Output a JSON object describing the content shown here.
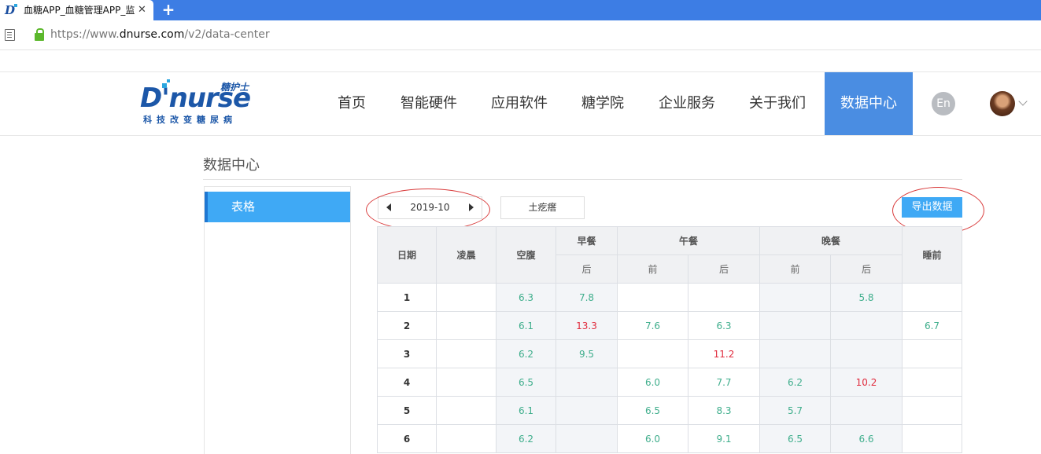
{
  "browser": {
    "tab_title": "血糖APP_血糖管理APP_监测",
    "tab_close": "✕",
    "new_tab": "+",
    "url_prefix": "https://www.",
    "url_domain": "dnurse.com",
    "url_path": "/v2/data-center"
  },
  "header": {
    "logo_word": "D'nurse",
    "logo_brand": "糖护士",
    "logo_slogan": "科技改变糖尿病",
    "nav": [
      "首页",
      "智能硬件",
      "应用软件",
      "糖学院",
      "企业服务",
      "关于我们",
      "数据中心"
    ],
    "active_nav": "数据中心",
    "lang": "En",
    "accent_color": "#4a8de2"
  },
  "page": {
    "title": "数据中心",
    "sidebar_items": [
      "表格"
    ],
    "month": "2019-10",
    "user_name": "土疙瘩",
    "export_label": "导出数据"
  },
  "table": {
    "headers": {
      "date": "日期",
      "dawn": "凌晨",
      "fasting": "空腹",
      "breakfast": "早餐",
      "lunch": "午餐",
      "dinner": "晚餐",
      "bedtime": "睡前",
      "before": "前",
      "after": "后"
    },
    "rows": [
      {
        "day": "1",
        "dawn": "",
        "fasting": "6.3",
        "breakfast_after": "7.8",
        "lunch_before": "",
        "lunch_after": "",
        "dinner_before": "",
        "dinner_after": "5.8",
        "bedtime": ""
      },
      {
        "day": "2",
        "dawn": "",
        "fasting": "6.1",
        "breakfast_after": "13.3",
        "lunch_before": "7.6",
        "lunch_after": "6.3",
        "dinner_before": "",
        "dinner_after": "",
        "bedtime": "6.7"
      },
      {
        "day": "3",
        "dawn": "",
        "fasting": "6.2",
        "breakfast_after": "9.5",
        "lunch_before": "",
        "lunch_after": "11.2",
        "dinner_before": "",
        "dinner_after": "",
        "bedtime": ""
      },
      {
        "day": "4",
        "dawn": "",
        "fasting": "6.5",
        "breakfast_after": "",
        "lunch_before": "6.0",
        "lunch_after": "7.7",
        "dinner_before": "6.2",
        "dinner_after": "10.2",
        "bedtime": ""
      },
      {
        "day": "5",
        "dawn": "",
        "fasting": "6.1",
        "breakfast_after": "",
        "lunch_before": "6.5",
        "lunch_after": "8.3",
        "dinner_before": "5.7",
        "dinner_after": "",
        "bedtime": ""
      },
      {
        "day": "6",
        "dawn": "",
        "fasting": "6.2",
        "breakfast_after": "",
        "lunch_before": "6.0",
        "lunch_after": "9.1",
        "dinner_before": "6.5",
        "dinner_after": "6.6",
        "bedtime": ""
      }
    ],
    "high_values": [
      "13.3",
      "11.2",
      "10.2"
    ],
    "colors": {
      "normal": "#3fae8c",
      "high": "#e02b3d"
    }
  }
}
